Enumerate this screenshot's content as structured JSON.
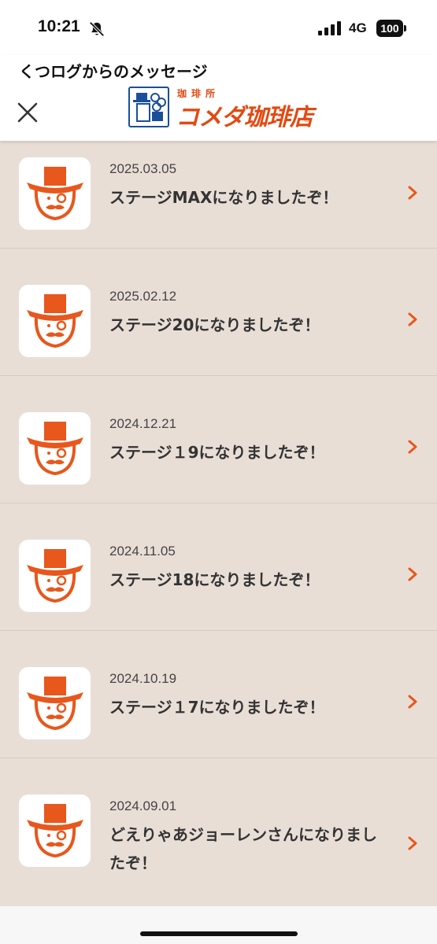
{
  "status_bar": {
    "time": "10:21",
    "network": "4G",
    "battery": "100"
  },
  "header": {
    "title": "くつログからのメッセージ",
    "logo_small": "珈琲所",
    "logo_text": "コメダ珈琲店",
    "logo_reg": "®"
  },
  "colors": {
    "accent": "#e8571c",
    "background": "#e9ded6"
  },
  "icons": [
    "bell-slash-icon",
    "signal-icon",
    "battery-icon",
    "close-icon",
    "komeda-mascot-icon",
    "chevron-right-icon"
  ],
  "messages": [
    {
      "date": "2025.03.05",
      "text": "ステージMAXになりましたぞ！"
    },
    {
      "date": "2025.02.12",
      "text": "ステージ20になりましたぞ！"
    },
    {
      "date": "2024.12.21",
      "text": "ステージ１9になりましたぞ！"
    },
    {
      "date": "2024.11.05",
      "text": "ステージ18になりましたぞ！"
    },
    {
      "date": "2024.10.19",
      "text": "ステージ１7になりましたぞ！"
    },
    {
      "date": "2024.09.01",
      "text": "どえりゃあジョーレンさんになりましたぞ！"
    }
  ]
}
